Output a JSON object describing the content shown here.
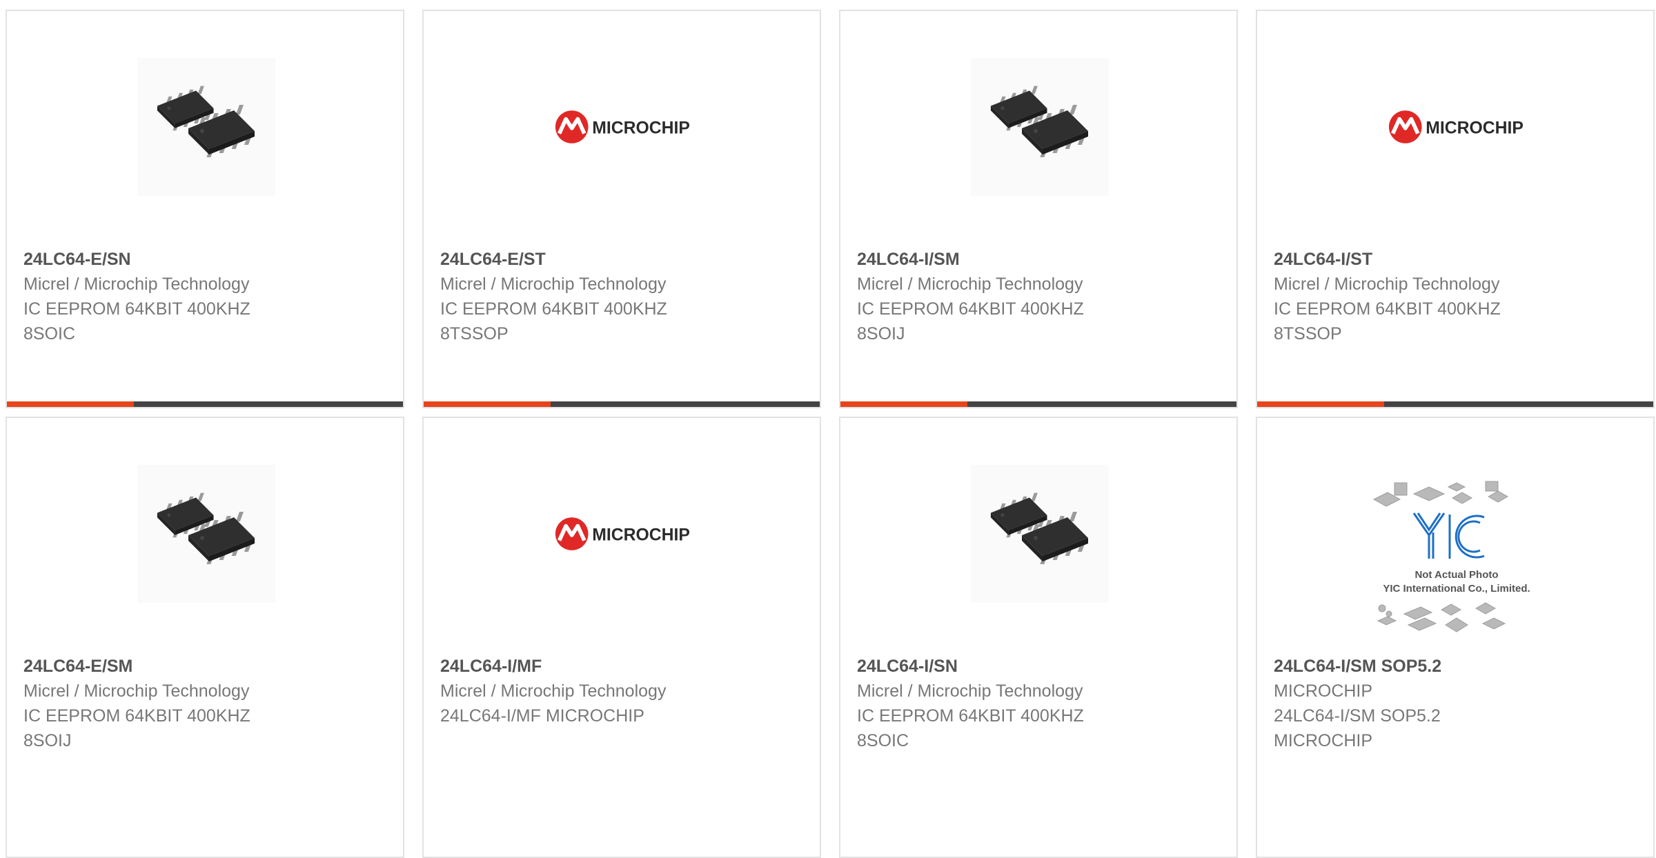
{
  "colors": {
    "accent": "#e8441c",
    "bar_dark": "#444444",
    "logo_red": "#e02826",
    "chip_dark": "#2b2b2b",
    "yic_blue": "#1e6fc5"
  },
  "products": [
    {
      "part_number": "24LC64-E/SN",
      "lines": [
        "Micrel / Microchip Technology",
        "IC EEPROM 64KBIT 400KHZ",
        "8SOIC"
      ],
      "image": "soic-chip-photo"
    },
    {
      "part_number": "24LC64-E/ST",
      "lines": [
        "Micrel / Microchip Technology",
        "IC EEPROM 64KBIT 400KHZ",
        "8TSSOP"
      ],
      "image": "microchip-logo",
      "logo_text": "MICROCHIP"
    },
    {
      "part_number": "24LC64-I/SM",
      "lines": [
        "Micrel / Microchip Technology",
        "IC EEPROM 64KBIT 400KHZ",
        "8SOIJ"
      ],
      "image": "soic-chip-photo"
    },
    {
      "part_number": "24LC64-I/ST",
      "lines": [
        "Micrel / Microchip Technology",
        "IC EEPROM 64KBIT 400KHZ",
        "8TSSOP"
      ],
      "image": "microchip-logo",
      "logo_text": "MICROCHIP"
    },
    {
      "part_number": "24LC64-E/SM",
      "lines": [
        "Micrel / Microchip Technology",
        "IC EEPROM 64KBIT 400KHZ",
        "8SOIJ"
      ],
      "image": "soic-chip-photo"
    },
    {
      "part_number": "24LC64-I/MF",
      "lines": [
        "Micrel / Microchip Technology",
        "24LC64-I/MF MICROCHIP",
        ""
      ],
      "image": "microchip-logo",
      "logo_text": "MICROCHIP"
    },
    {
      "part_number": "24LC64-I/SN",
      "lines": [
        "Micrel / Microchip Technology",
        "IC EEPROM 64KBIT 400KHZ",
        "8SOIC"
      ],
      "image": "soic-chip-photo"
    },
    {
      "part_number": "24LC64-I/SM SOP5.2",
      "lines": [
        "MICROCHIP",
        "24LC64-I/SM SOP5.2",
        "MICROCHIP"
      ],
      "image": "yic-placeholder",
      "yic_caption_1": "Not Actual Photo",
      "yic_caption_2": "YIC International Co., Limited."
    }
  ]
}
